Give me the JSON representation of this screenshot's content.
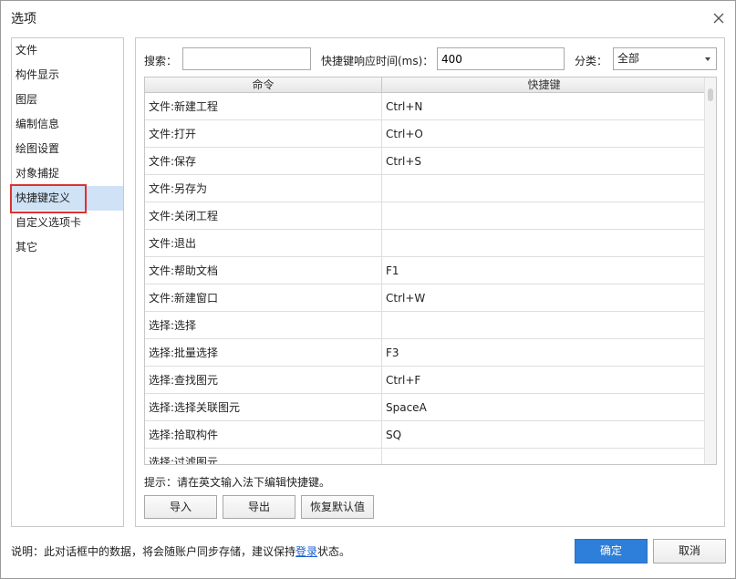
{
  "window": {
    "title": "选项"
  },
  "sidebar": {
    "items": [
      {
        "label": "文件",
        "selected": false
      },
      {
        "label": "构件显示",
        "selected": false
      },
      {
        "label": "图层",
        "selected": false
      },
      {
        "label": "编制信息",
        "selected": false
      },
      {
        "label": "绘图设置",
        "selected": false
      },
      {
        "label": "对象捕捉",
        "selected": false
      },
      {
        "label": "快捷键定义",
        "selected": true
      },
      {
        "label": "自定义选项卡",
        "selected": false
      },
      {
        "label": "其它",
        "selected": false
      }
    ]
  },
  "filters": {
    "search_label": "搜索：",
    "search_value": "",
    "delay_label": "快捷键响应时间(ms)：",
    "delay_value": "400",
    "category_label": "分类：",
    "category_value": "全部"
  },
  "table": {
    "columns": [
      "命令",
      "快捷键"
    ],
    "rows": [
      {
        "command": "文件:新建工程",
        "shortcut": "Ctrl+N"
      },
      {
        "command": "文件:打开",
        "shortcut": "Ctrl+O"
      },
      {
        "command": "文件:保存",
        "shortcut": "Ctrl+S"
      },
      {
        "command": "文件:另存为",
        "shortcut": ""
      },
      {
        "command": "文件:关闭工程",
        "shortcut": ""
      },
      {
        "command": "文件:退出",
        "shortcut": ""
      },
      {
        "command": "文件:帮助文档",
        "shortcut": "F1"
      },
      {
        "command": "文件:新建窗口",
        "shortcut": "Ctrl+W"
      },
      {
        "command": "选择:选择",
        "shortcut": ""
      },
      {
        "command": "选择:批量选择",
        "shortcut": "F3"
      },
      {
        "command": "选择:查找图元",
        "shortcut": "Ctrl+F"
      },
      {
        "command": "选择:选择关联图元",
        "shortcut": "SpaceA"
      },
      {
        "command": "选择:拾取构件",
        "shortcut": "SQ"
      },
      {
        "command": "选择:过滤图元",
        "shortcut": ""
      }
    ]
  },
  "hint": "提示：请在英文输入法下编辑快捷键。",
  "actions": {
    "import": "导入",
    "export": "导出",
    "reset": "恢复默认值"
  },
  "footer": {
    "note_prefix": "说明：此对话框中的数据，将会随账户同步存储，建议保持",
    "note_link": "登录",
    "note_suffix": "状态。",
    "ok": "确定",
    "cancel": "取消"
  },
  "colors": {
    "accent": "#2e7fd9",
    "selected_bg": "#cfe2f6",
    "highlight_outline": "#e0302e"
  }
}
